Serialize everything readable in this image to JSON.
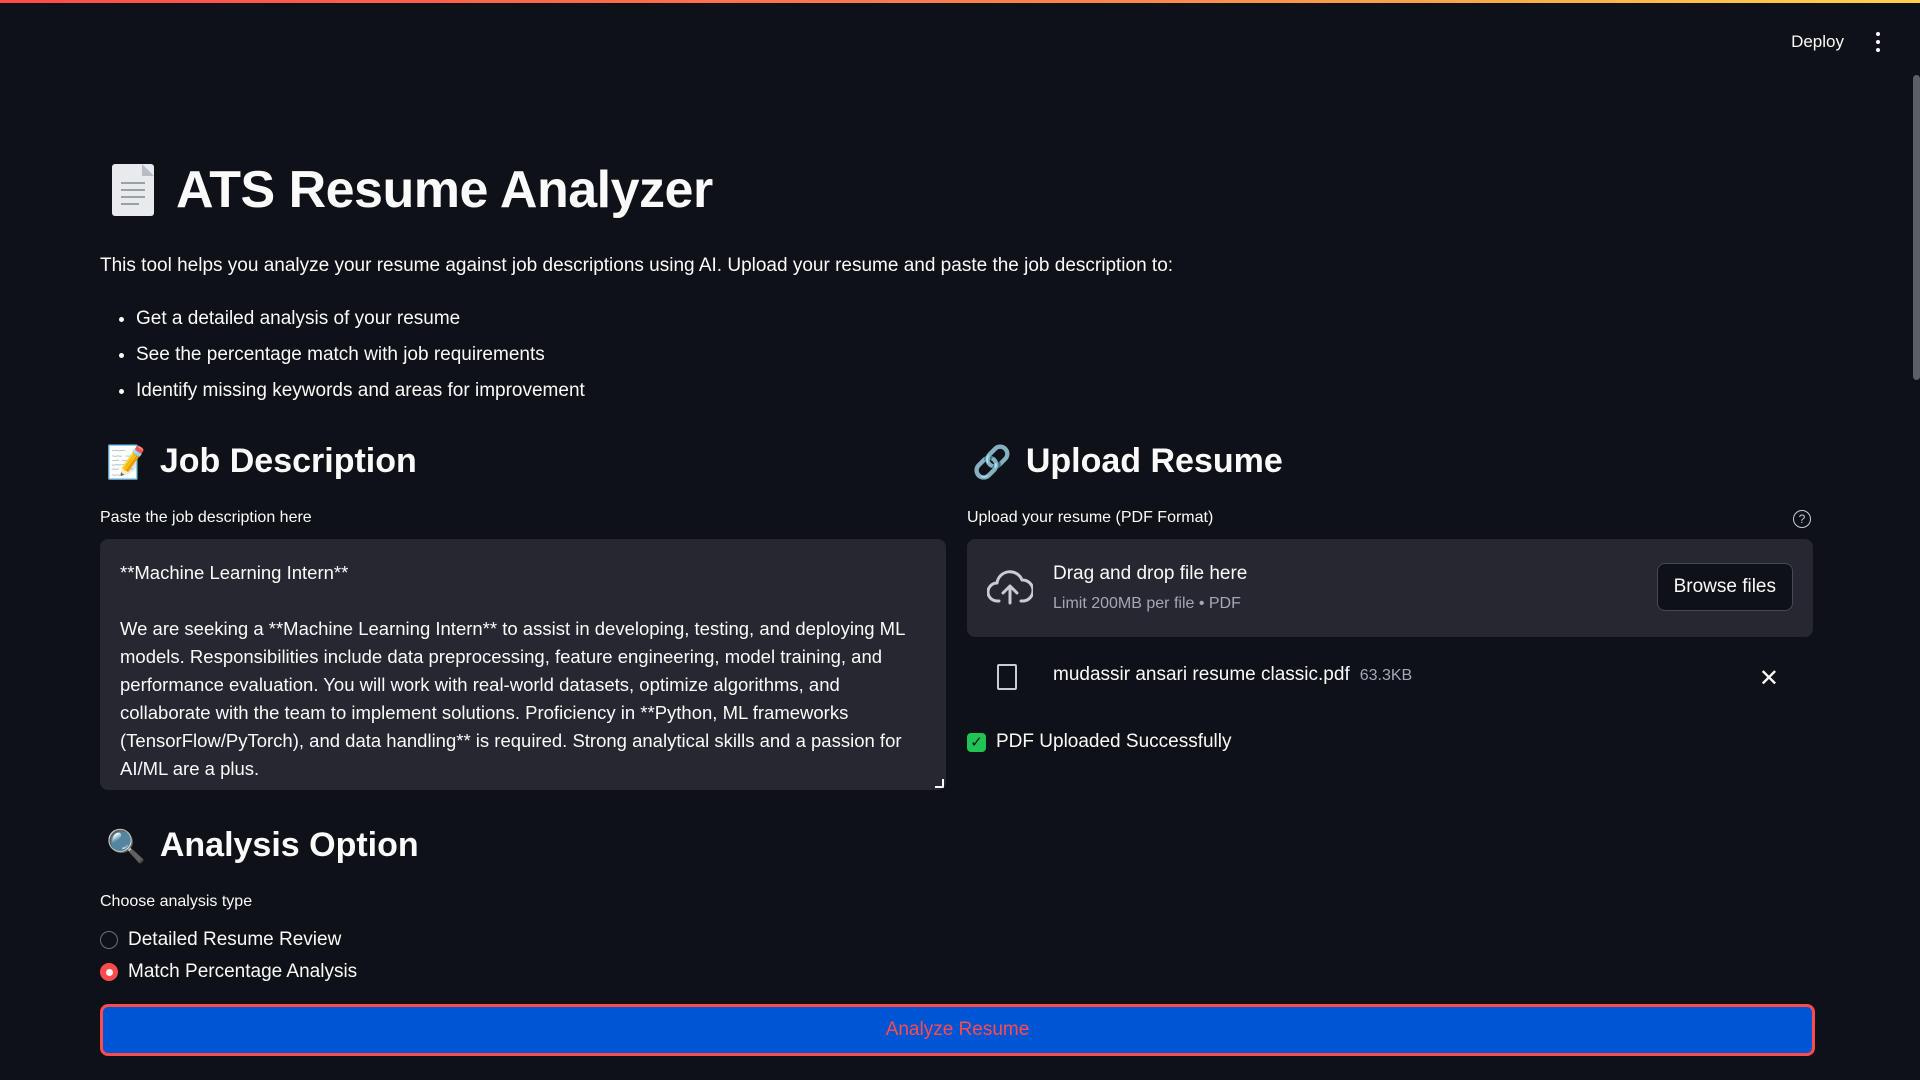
{
  "header": {
    "deploy_label": "Deploy",
    "menu_icon": "kebab-menu-icon"
  },
  "page": {
    "title": "ATS Resume Analyzer",
    "title_icon": "document-icon",
    "intro": "This tool helps you analyze your resume against job descriptions using AI. Upload your resume and paste the job description to:",
    "bullets": [
      "Get a detailed analysis of your resume",
      "See the percentage match with job requirements",
      "Identify missing keywords and areas for improvement"
    ]
  },
  "job_description": {
    "heading": "Job Description",
    "heading_emoji": "📝",
    "label": "Paste the job description here",
    "value_title": "**Machine Learning Intern**",
    "value_body": "We are seeking a **Machine Learning Intern** to assist in developing, testing, and deploying ML models. Responsibilities include data preprocessing, feature engineering, model training, and performance evaluation. You will work with real-world datasets, optimize algorithms, and collaborate with the team to implement solutions. Proficiency in **Python, ML frameworks (TensorFlow/PyTorch), and data handling** is required. Strong analytical skills and a passion for AI/ML are a plus."
  },
  "upload": {
    "heading": "Upload Resume",
    "heading_emoji": "🔗",
    "label": "Upload your resume (PDF Format)",
    "help_symbol": "?",
    "dropzone_title": "Drag and drop file here",
    "dropzone_subtitle": "Limit 200MB per file • PDF",
    "browse_label": "Browse files",
    "file_name": "mudassir ansari resume classic.pdf",
    "file_size": "63.3KB",
    "close_symbol": "✕",
    "success_label": "PDF Uploaded Successfully",
    "check_symbol": "✓"
  },
  "analysis": {
    "heading": "Analysis Option",
    "heading_emoji": "🔍",
    "label": "Choose analysis type",
    "options": [
      {
        "label": "Detailed Resume Review",
        "selected": false
      },
      {
        "label": "Match Percentage Analysis",
        "selected": true
      }
    ],
    "button_label": "Analyze Resume"
  },
  "colors": {
    "background": "#0e1117",
    "input_bg": "#262730",
    "accent_red": "#ff4b4b",
    "button_blue": "#0055d4",
    "success_green": "#21c354"
  }
}
